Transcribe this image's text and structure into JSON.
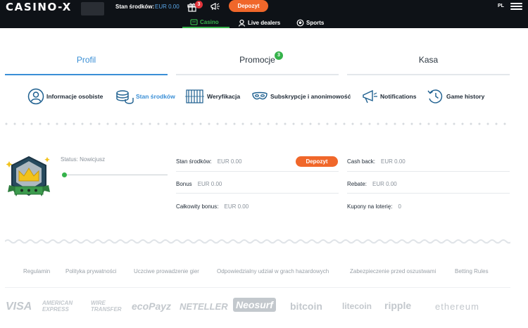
{
  "header": {
    "logo": "CASINO-X",
    "balance_label": "Stan środków:",
    "balance_value": "EUR 0.00",
    "gift_count": "3",
    "deposit_label": "Depozyt",
    "language": "PL",
    "nav": [
      {
        "label": "Casino",
        "icon": "cards-icon"
      },
      {
        "label": "Live dealers",
        "icon": "dealer-icon"
      },
      {
        "label": "Sports",
        "icon": "ball-icon"
      }
    ]
  },
  "tabs": [
    {
      "label": "Profil"
    },
    {
      "label": "Promocje",
      "badge": "3"
    },
    {
      "label": "Kasa"
    }
  ],
  "subtabs": [
    {
      "label": "Informacje osobiste",
      "icon": "person-icon"
    },
    {
      "label": "Stan środków",
      "icon": "coins-icon"
    },
    {
      "label": "Weryfikacja",
      "icon": "verification-icon"
    },
    {
      "label": "Subskrypcje i anonimowość",
      "icon": "mask-icon"
    },
    {
      "label": "Notifications",
      "icon": "megaphone-icon"
    },
    {
      "label": "Game history",
      "icon": "history-icon"
    }
  ],
  "profile": {
    "status_label": "Status:",
    "status_value": "Nowicjusz",
    "progress": 0
  },
  "balances": {
    "stan_label": "Stan środków:",
    "stan_value": "EUR 0.00",
    "deposit_label": "Depozyt",
    "bonus_label": "Bonus",
    "bonus_value": "EUR 0.00",
    "total_bonus_label": "Całkowity bonus:",
    "total_bonus_value": "EUR 0.00",
    "cashback_label": "Cash back:",
    "cashback_value": "EUR 0.00",
    "rebate_label": "Rebate:",
    "rebate_value": "EUR 0.00",
    "coupons_label": "Kupony na loterię:",
    "coupons_value": "0"
  },
  "footer": {
    "links": [
      "Regulamin",
      "Polityka prywatności",
      "Uczciwe prowadzenie gier",
      "Odpowiedzialny udział w grach hazardowych",
      "Zabezpieczenie przed oszustwami",
      "Betting Rules"
    ],
    "payments": [
      "VISA",
      "AMERICAN EXPRESS",
      "WIRE TRANSFER",
      "ecoPayz",
      "NETELLER",
      "Neosurf",
      "bitcoin",
      "litecoin",
      "ripple",
      "ethereum"
    ]
  }
}
